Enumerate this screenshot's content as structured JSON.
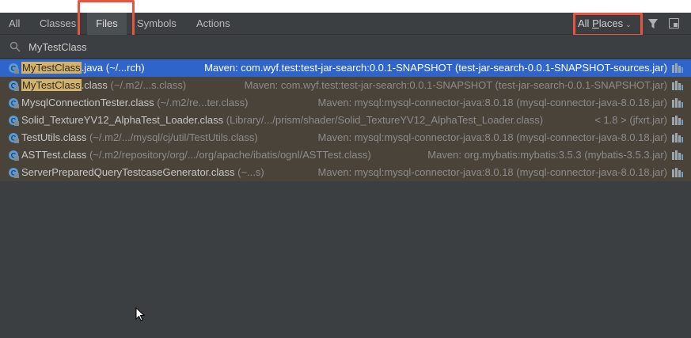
{
  "tabs": [
    {
      "label": "All",
      "selected": false
    },
    {
      "label": "Classes",
      "selected": false
    },
    {
      "label": "Files",
      "selected": true
    },
    {
      "label": "Symbols",
      "selected": false
    },
    {
      "label": "Actions",
      "selected": false
    }
  ],
  "scope": {
    "prefix": "All ",
    "mnemonic": "P",
    "suffix": "laces"
  },
  "icons": {
    "filter": "filter-icon",
    "window": "open-in-window-icon",
    "search": "search-icon",
    "file": "class-file-icon",
    "library": "library-jar-icon"
  },
  "search": {
    "value": "MyTestClass",
    "placeholder": ""
  },
  "colors": {
    "selection": "#2f65ca",
    "highlight": "#d5b26a",
    "annotation_box": "#e8553e",
    "row_bg": "#4a4339"
  },
  "results": [
    {
      "match": "MyTestClass",
      "rest": ".java",
      "path": " (~/...rch)",
      "lib": "Maven: com.wyf.test:test-jar-search:0.0.1-SNAPSHOT (test-jar-search-0.0.1-SNAPSHOT-sources.jar)"
    },
    {
      "match": "MyTestClass",
      "rest": ".class",
      "path": " (~/.m2/...s.class)",
      "lib": "Maven: com.wyf.test:test-jar-search:0.0.1-SNAPSHOT (test-jar-search-0.0.1-SNAPSHOT.jar)"
    },
    {
      "match": "",
      "rest": "MysqlConnectionTester.class",
      "path": " (~/.m2/re...ter.class)",
      "lib": "Maven: mysql:mysql-connector-java:8.0.18 (mysql-connector-java-8.0.18.jar)"
    },
    {
      "match": "",
      "rest": "Solid_TextureYV12_AlphaTest_Loader.class",
      "path": " (Library/.../prism/shader/Solid_TextureYV12_AlphaTest_Loader.class)",
      "lib": "< 1.8 > (jfxrt.jar)"
    },
    {
      "match": "",
      "rest": "TestUtils.class",
      "path": " (~/.m2/.../mysql/cj/util/TestUtils.class)",
      "lib": "Maven: mysql:mysql-connector-java:8.0.18 (mysql-connector-java-8.0.18.jar)"
    },
    {
      "match": "",
      "rest": "ASTTest.class",
      "path": " (~/.m2/repository/org/.../org/apache/ibatis/ognl/ASTTest.class)",
      "lib": "Maven: org.mybatis:mybatis:3.5.3 (mybatis-3.5.3.jar)"
    },
    {
      "match": "",
      "rest": "ServerPreparedQueryTestcaseGenerator.class",
      "path": " (~...s)",
      "lib": "Maven: mysql:mysql-connector-java:8.0.18 (mysql-connector-java-8.0.18.jar)"
    }
  ]
}
